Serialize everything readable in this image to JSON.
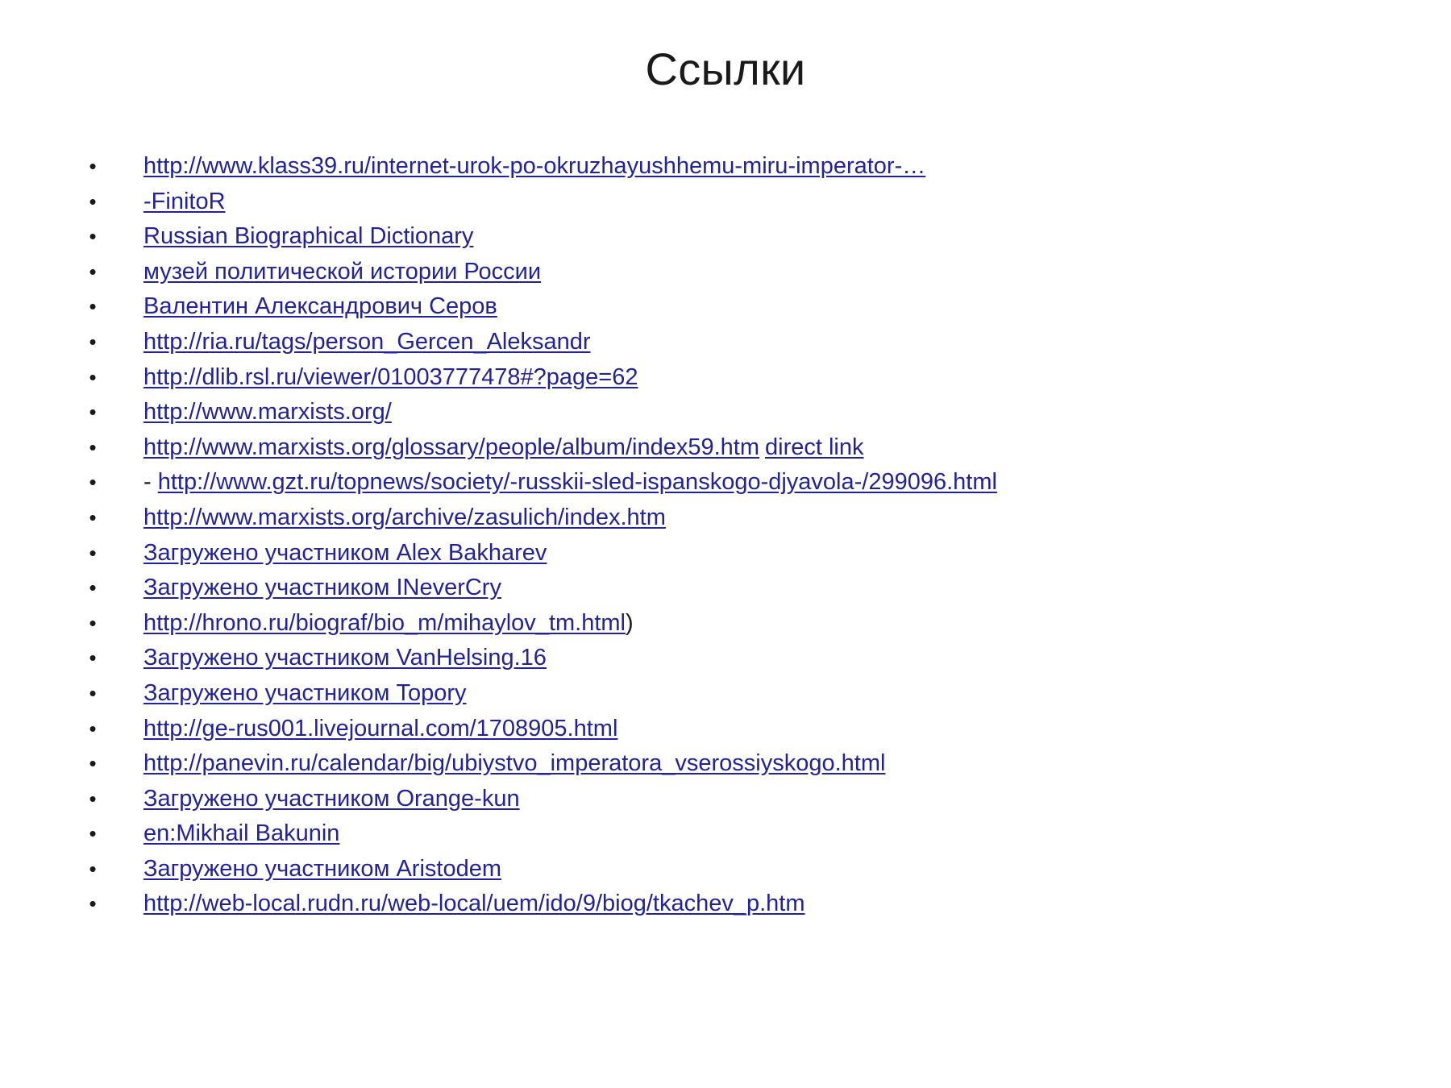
{
  "slide": {
    "title": "Ссылки",
    "bullet_glyph": "•",
    "link_color": "#22229C",
    "text_color": "#1a1a1a",
    "background_color": "#ffffff"
  },
  "links": [
    {
      "prefix": "",
      "text": "http://www.klass39.ru/internet-urok-po-okruzhayushhemu-miru-imperator-…",
      "suffix": "",
      "extra": ""
    },
    {
      "prefix": "",
      "text": "-FinitoR",
      "suffix": "",
      "extra": ""
    },
    {
      "prefix": "",
      "text": "Russian Biographical Dictionary",
      "suffix": "",
      "extra": ""
    },
    {
      "prefix": "",
      "text": "музей политической истории России",
      "suffix": "",
      "extra": ""
    },
    {
      "prefix": "",
      "text": "Валентин Александрович Серов",
      "suffix": "",
      "extra": ""
    },
    {
      "prefix": "",
      "text": "http://ria.ru/tags/person_Gercen_Aleksandr",
      "suffix": "",
      "extra": ""
    },
    {
      "prefix": "",
      "text": "http://dlib.rsl.ru/viewer/01003777478#?page=62",
      "suffix": "",
      "extra": ""
    },
    {
      "prefix": "",
      "text": "http://www.marxists.org/",
      "suffix": "",
      "extra": ""
    },
    {
      "prefix": "",
      "text": "http://www.marxists.org/glossary/people/album/index59.htm",
      "suffix": "",
      "extra": "direct link"
    },
    {
      "prefix": "- ",
      "text": "http://www.gzt.ru/topnews/society/-russkii-sled-ispanskogo-djyavola-/299096.html",
      "suffix": "",
      "extra": ""
    },
    {
      "prefix": "",
      "text": "http://www.marxists.org/archive/zasulich/index.htm",
      "suffix": "",
      "extra": ""
    },
    {
      "prefix": "",
      "text": "Загружено участником Alex Bakharev",
      "suffix": "",
      "extra": ""
    },
    {
      "prefix": "",
      "text": "Загружено участником INeverCry",
      "suffix": "",
      "extra": ""
    },
    {
      "prefix": "",
      "text": "http://hrono.ru/biograf/bio_m/mihaylov_tm.html",
      "suffix": ")",
      "extra": ""
    },
    {
      "prefix": "",
      "text": "Загружено участником VanHelsing.16",
      "suffix": "",
      "extra": ""
    },
    {
      "prefix": "",
      "text": "Загружено участником Topory",
      "suffix": "",
      "extra": ""
    },
    {
      "prefix": "",
      "text": "http://ge-rus001.livejournal.com/1708905.html",
      "suffix": "",
      "extra": ""
    },
    {
      "prefix": "",
      "text": "http://panevin.ru/calendar/big/ubiystvo_imperatora_vserossiyskogo.html",
      "suffix": "",
      "extra": ""
    },
    {
      "prefix": "",
      "text": "Загружено участником Orange-kun",
      "suffix": "",
      "extra": ""
    },
    {
      "prefix": "",
      "text": "en:Mikhail Bakunin",
      "suffix": "",
      "extra": ""
    },
    {
      "prefix": "",
      "text": "Загружено участником Aristodem",
      "suffix": "",
      "extra": ""
    },
    {
      "prefix": "",
      "text": "http://web-local.rudn.ru/web-local/uem/ido/9/biog/tkachev_p.htm",
      "suffix": "",
      "extra": ""
    }
  ]
}
